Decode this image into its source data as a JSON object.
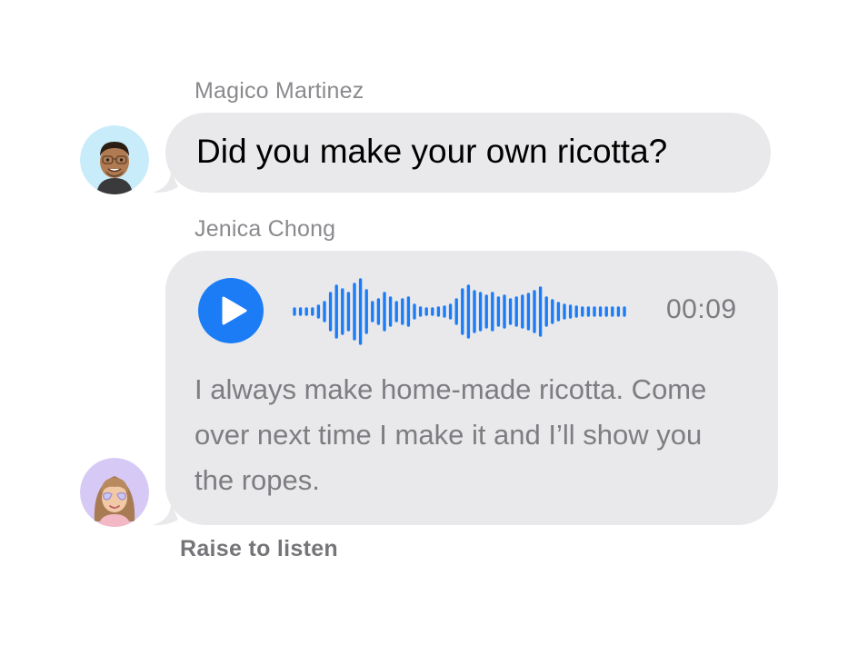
{
  "messages": [
    {
      "sender": "Magico Martinez",
      "text": "Did you make your own ricotta?"
    },
    {
      "sender": "Jenica Chong",
      "audio": {
        "duration": "00:09",
        "transcript": "I always make home-made ricotta. Come over next time I make it and I’ll show you the ropes."
      }
    }
  ],
  "footer": {
    "raise_to_listen": "Raise to listen"
  },
  "colors": {
    "accent": "#1c7cf6",
    "bubble": "#e9e9eb",
    "secondary_text": "#8a8a8e"
  },
  "icons": {
    "play": "play-icon",
    "waveform": "waveform-icon",
    "avatar_1": "memoji-man-glasses",
    "avatar_2": "memoji-woman-bangs"
  }
}
